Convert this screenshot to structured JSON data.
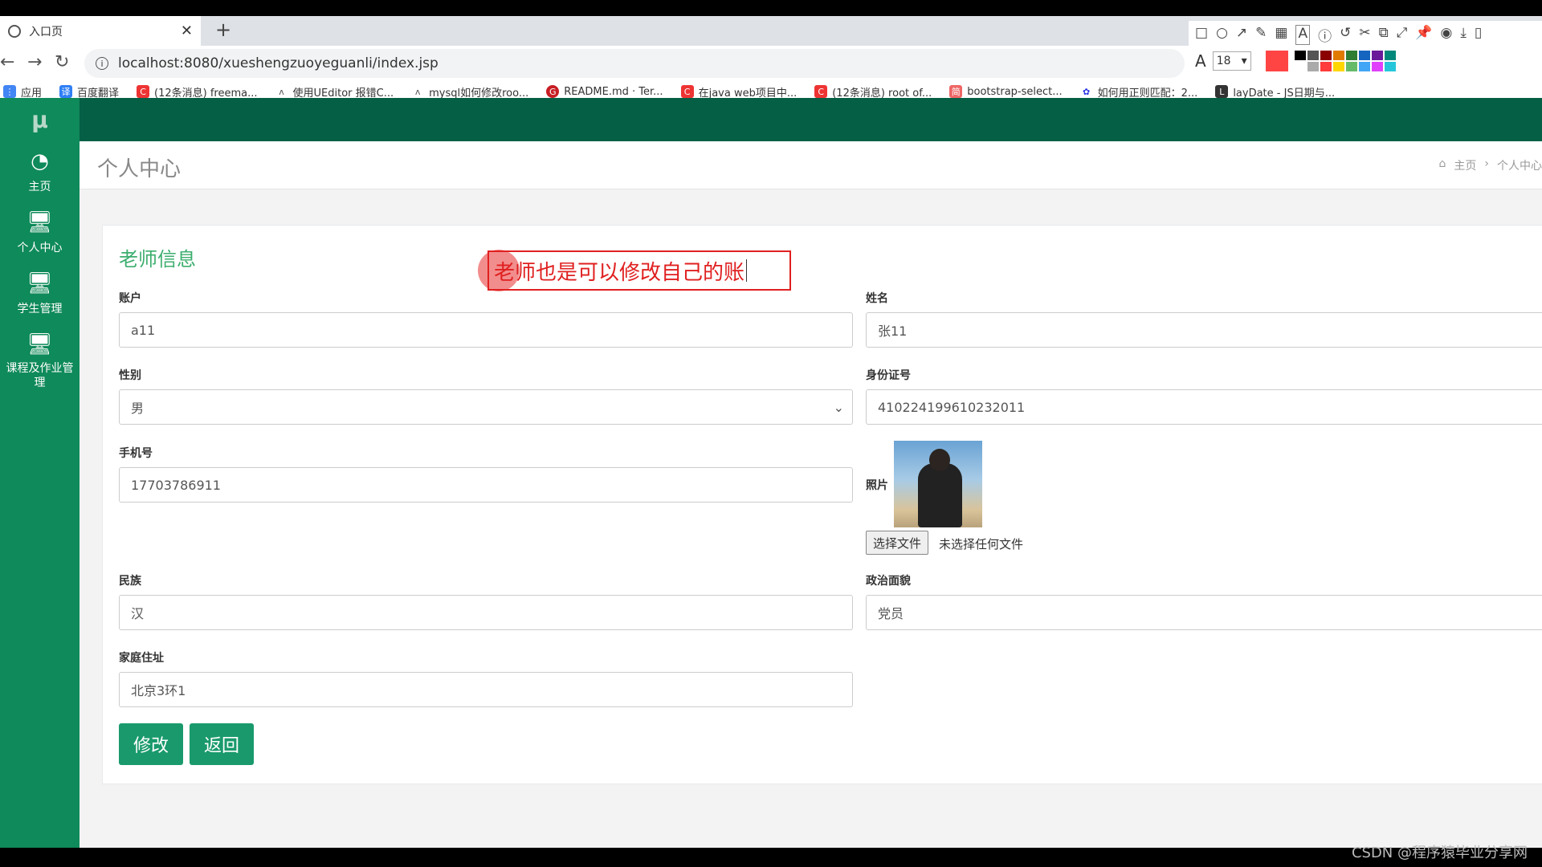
{
  "browser": {
    "tab_title": "入口页",
    "url": "localhost:8080/xueshengzuoyeguanli/index.jsp",
    "bookmarks": [
      {
        "label": "应用",
        "color": "#4285f4"
      },
      {
        "label": "百度翻译",
        "color": "#2f7ff5"
      },
      {
        "label": "(12条消息) freema...",
        "color": "#e33"
      },
      {
        "label": "使用UEditor 报错C...",
        "color": "#555"
      },
      {
        "label": "mysql如何修改roo...",
        "color": "#555"
      },
      {
        "label": "README.md · Ter...",
        "color": "#c71d23"
      },
      {
        "label": "在java web项目中...",
        "color": "#e33"
      },
      {
        "label": "(12条消息) root of...",
        "color": "#e33"
      },
      {
        "label": "bootstrap-select...",
        "color": "#e66"
      },
      {
        "label": "如何用正则匹配：2...",
        "color": "#2932e1"
      },
      {
        "label": "layDate - JS日期与...",
        "color": "#333"
      }
    ]
  },
  "draw_toolbar": {
    "font_size": "18",
    "current_color": "#ff4444",
    "swatches": [
      "#000000",
      "#555555",
      "#8b0000",
      "#e07b00",
      "#2e7d32",
      "#1565c0",
      "#6a1b9a",
      "#00897b",
      "#ffffff",
      "#aaaaaa",
      "#ff3b3b",
      "#ffd600",
      "#66bb6a",
      "#42a5f5",
      "#e040fb",
      "#26c6da"
    ]
  },
  "sidebar": {
    "logo": "μ",
    "items": [
      {
        "label": "主页",
        "icon": "dashboard-icon"
      },
      {
        "label": "个人中心",
        "icon": "monitor-icon"
      },
      {
        "label": "学生管理",
        "icon": "monitor-icon"
      },
      {
        "label": "课程及作业管理",
        "icon": "monitor-icon"
      }
    ]
  },
  "header": {
    "page_title": "个人中心",
    "breadcrumb_home": "主页",
    "breadcrumb_current": "个人中心"
  },
  "form": {
    "section_title": "老师信息",
    "account_label": "账户",
    "account_value": "a11",
    "name_label": "姓名",
    "name_value": "张11",
    "gender_label": "性别",
    "gender_value": "男",
    "idcard_label": "身份证号",
    "idcard_value": "410224199610232011",
    "phone_label": "手机号",
    "phone_value": "17703786911",
    "photo_label": "照片",
    "file_button": "选择文件",
    "file_status": "未选择任何文件",
    "ethnicity_label": "民族",
    "ethnicity_value": "汉",
    "political_label": "政治面貌",
    "political_value": "党员",
    "address_label": "家庭住址",
    "address_value": "北京3环1",
    "modify_button": "修改",
    "back_button": "返回"
  },
  "annotation": {
    "text": "老师也是可以修改自己的账"
  },
  "watermark": "CSDN @程序猿毕业分享网"
}
